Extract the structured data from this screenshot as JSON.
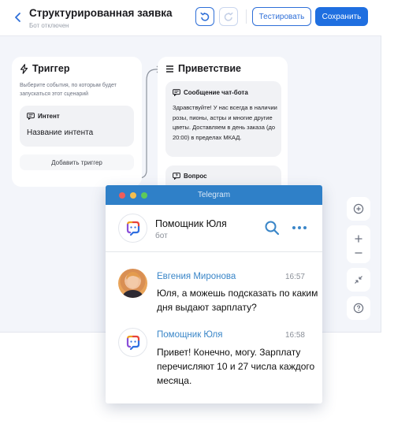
{
  "header": {
    "title": "Структурированная заявка",
    "subtitle": "Бот отключен",
    "test_label": "Тестировать",
    "save_label": "Сохранить"
  },
  "trigger_card": {
    "title": "Триггер",
    "hint": "Выберите события, по которым будет запускаться этот сценарий",
    "intent_label": "Интент",
    "intent_value": "Название интента",
    "add_trigger_label": "Добавить триггер"
  },
  "greeting_card": {
    "title": "Приветствие",
    "message_label": "Сообщение чат-бота",
    "message_text": "Здравствуйте! У нас всегда в наличии розы, пионы, астры и многие другие цветы. Доставляем в день заказа (до 20:00) в пределах МКАД.",
    "question_label": "Вопрос"
  },
  "telegram": {
    "window_title": "Telegram",
    "chat_name": "Помощник Юля",
    "chat_status": "бот",
    "messages": [
      {
        "author": "Евгения Миронова",
        "time": "16:57",
        "text": "Юля, а можешь подсказать по каким дня выдают зарплату?"
      },
      {
        "author": "Помощник Юля",
        "time": "16:58",
        "text": "Привет! Конечно, могу. Зарплату перечисляют 10 и 27 числа каждого месяца."
      }
    ]
  },
  "colors": {
    "accent": "#1f6fe0",
    "canvas": "#f3f5fa",
    "telegram_bar": "#2f80c8",
    "link_name": "#3a86c8"
  },
  "icons": [
    "back-icon",
    "undo-icon",
    "redo-icon",
    "lightning-icon",
    "list-icon",
    "chat-icon",
    "question-icon",
    "add-icon",
    "zoom-in-icon",
    "zoom-out-icon",
    "collapse-icon",
    "help-icon",
    "search-icon",
    "more-icon",
    "bot-logo-icon"
  ]
}
